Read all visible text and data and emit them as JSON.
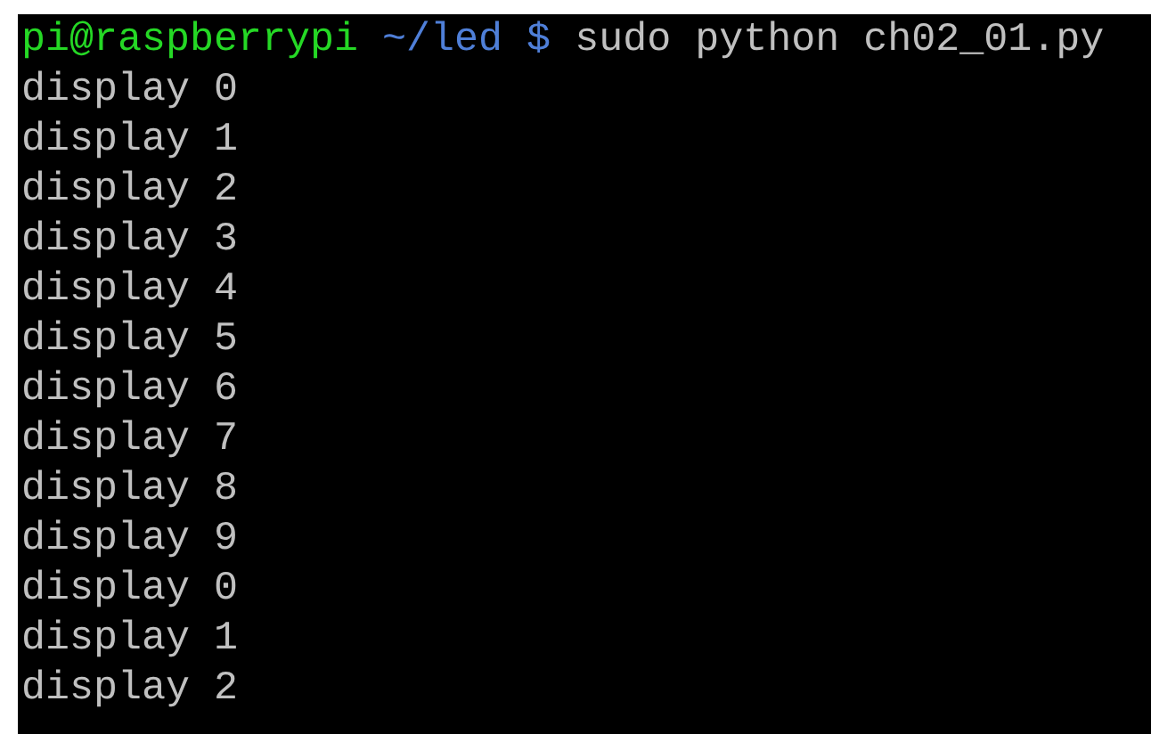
{
  "prompt": {
    "user_host": "pi@raspberrypi",
    "path": "~/led",
    "symbol": "$",
    "command": "sudo python ch02_01.py"
  },
  "output": [
    "display 0",
    "display 1",
    "display 2",
    "display 3",
    "display 4",
    "display 5",
    "display 6",
    "display 7",
    "display 8",
    "display 9",
    "display 0",
    "display 1",
    "display 2"
  ]
}
